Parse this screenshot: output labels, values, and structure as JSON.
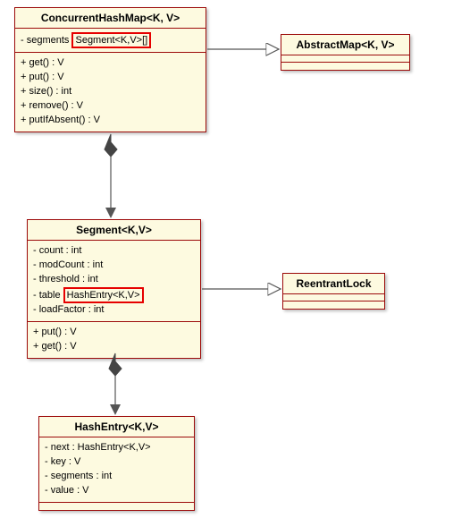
{
  "classes": {
    "chm": {
      "name": "ConcurrentHashMap<K, V>",
      "attrs": [
        {
          "prefix": "- segments",
          "hl": "Segment<K,V>[]"
        }
      ],
      "ops": [
        "+ get() : V",
        "+ put() : V",
        "+ size() : int",
        "+ remove() : V",
        "+ putIfAbsent() : V"
      ]
    },
    "am": {
      "name": "AbstractMap<K, V>"
    },
    "seg": {
      "name": "Segment<K,V>",
      "attrs": [
        "- count : int",
        "- modCount : int",
        "- threshold : int",
        {
          "prefix": "- table",
          "hl": "HashEntry<K,V>"
        },
        "- loadFactor : int"
      ],
      "ops": [
        "+ put() : V",
        "+ get() : V"
      ]
    },
    "rl": {
      "name": "ReentrantLock"
    },
    "he": {
      "name": "HashEntry<K,V>",
      "attrs": [
        "- next : HashEntry<K,V>",
        "- key : V",
        "- segments : int",
        "- value : V"
      ]
    }
  },
  "chart_data": {
    "type": "uml_class_diagram",
    "classes": [
      {
        "id": "ConcurrentHashMap<K,V>",
        "stereotype": "class",
        "attributes": [
          "- segments : Segment<K,V>[]"
        ],
        "operations": [
          "+ get():V",
          "+ put():V",
          "+ size():int",
          "+ remove():V",
          "+ putIfAbsent():V"
        ]
      },
      {
        "id": "AbstractMap<K,V>",
        "stereotype": "class"
      },
      {
        "id": "Segment<K,V>",
        "stereotype": "class",
        "attributes": [
          "- count:int",
          "- modCount:int",
          "- threshold:int",
          "- table:HashEntry<K,V>",
          "- loadFactor:int"
        ],
        "operations": [
          "+ put():V",
          "+ get():V"
        ]
      },
      {
        "id": "ReentrantLock",
        "stereotype": "class"
      },
      {
        "id": "HashEntry<K,V>",
        "stereotype": "class",
        "attributes": [
          "- next:HashEntry<K,V>",
          "- key:V",
          "- segments:int",
          "- value:V"
        ]
      }
    ],
    "relationships": [
      {
        "from": "ConcurrentHashMap<K,V>",
        "to": "AbstractMap<K,V>",
        "type": "generalization"
      },
      {
        "from": "ConcurrentHashMap<K,V>",
        "to": "Segment<K,V>",
        "type": "composition"
      },
      {
        "from": "Segment<K,V>",
        "to": "ReentrantLock",
        "type": "generalization"
      },
      {
        "from": "Segment<K,V>",
        "to": "HashEntry<K,V>",
        "type": "composition"
      }
    ]
  }
}
